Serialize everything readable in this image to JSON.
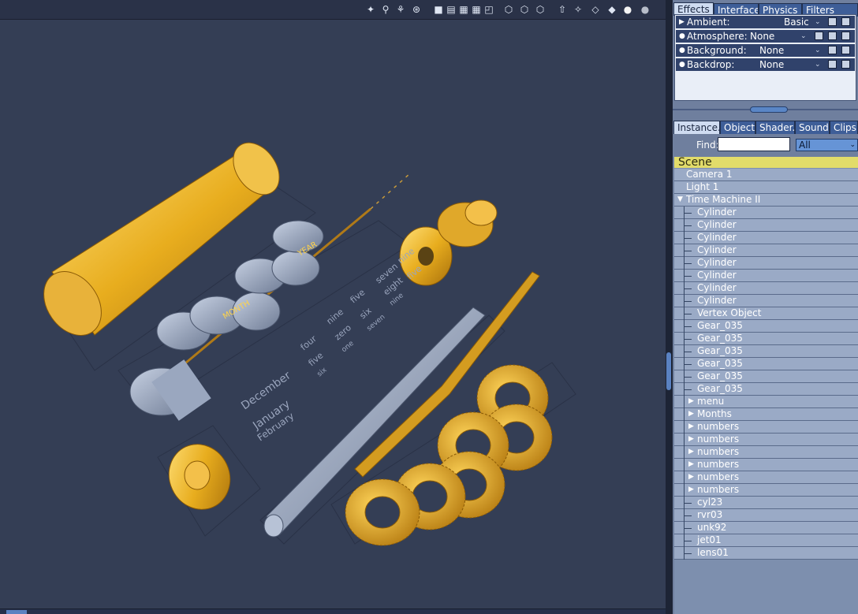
{
  "viewport_toolbar": {
    "icons": [
      "camera-icon",
      "figure-icon",
      "walk-icon",
      "sphere-grid-icon",
      "single-view-icon",
      "two-view-icon",
      "three-view-icon",
      "four-view-icon",
      "split-view-icon",
      "cube-wire-icon",
      "cube-lit-icon",
      "cube-shade-icon",
      "light-icon",
      "rotate-icon",
      "box-icon",
      "hidden-line-icon",
      "shaded-sphere-icon",
      "texture-sphere-icon"
    ]
  },
  "scene_labels": {
    "months": [
      "December",
      "January",
      "February"
    ],
    "numbers_col1": [
      "four",
      "five",
      "six"
    ],
    "numbers_col2": [
      "nine",
      "zero",
      "one"
    ],
    "numbers_col3": [
      "five",
      "six",
      "seven"
    ],
    "numbers_col4": [
      "seven",
      "eight",
      "nine"
    ],
    "numbers_col5": [
      "nine",
      "five"
    ],
    "bar_text_1": "MONTH",
    "bar_text_2": "YEAR"
  },
  "panel": {
    "effects_tabs": [
      "Effects",
      "Interface",
      "Physics",
      "Filters"
    ],
    "effects_rows": [
      {
        "label": "Ambient:",
        "value": "Basic",
        "marker": "▶"
      },
      {
        "label": "Atmosphere:",
        "value": "None",
        "marker": "●"
      },
      {
        "label": "Background:",
        "value": "None",
        "marker": "●"
      },
      {
        "label": "Backdrop:",
        "value": "None",
        "marker": "●"
      }
    ],
    "lower_tabs": [
      "Instance.",
      "Object.",
      "Shader.",
      "Sound.",
      "Clips"
    ],
    "find_label": "Find:",
    "find_value": "",
    "filter_value": "All",
    "scene_label": "Scene",
    "tree": [
      {
        "label": "Camera 1",
        "indent": 0
      },
      {
        "label": "Light 1",
        "indent": 0
      },
      {
        "label": "Time Machine II",
        "indent": 0,
        "expanded": true
      },
      {
        "label": "Cylinder",
        "indent": 1
      },
      {
        "label": "Cylinder",
        "indent": 1
      },
      {
        "label": "Cylinder",
        "indent": 1
      },
      {
        "label": "Cylinder",
        "indent": 1
      },
      {
        "label": "Cylinder",
        "indent": 1
      },
      {
        "label": "Cylinder",
        "indent": 1
      },
      {
        "label": "Cylinder",
        "indent": 1
      },
      {
        "label": "Cylinder",
        "indent": 1
      },
      {
        "label": "Vertex Object",
        "indent": 1
      },
      {
        "label": "Gear_035",
        "indent": 1
      },
      {
        "label": "Gear_035",
        "indent": 1
      },
      {
        "label": "Gear_035",
        "indent": 1
      },
      {
        "label": "Gear_035",
        "indent": 1
      },
      {
        "label": "Gear_035",
        "indent": 1
      },
      {
        "label": "Gear_035",
        "indent": 1
      },
      {
        "label": "menu",
        "indent": 1,
        "group": true
      },
      {
        "label": "Months",
        "indent": 1,
        "group": true
      },
      {
        "label": "numbers",
        "indent": 1,
        "group": true
      },
      {
        "label": "numbers",
        "indent": 1,
        "group": true
      },
      {
        "label": "numbers",
        "indent": 1,
        "group": true
      },
      {
        "label": "numbers",
        "indent": 1,
        "group": true
      },
      {
        "label": "numbers",
        "indent": 1,
        "group": true
      },
      {
        "label": "numbers",
        "indent": 1,
        "group": true
      },
      {
        "label": "cyl23",
        "indent": 1
      },
      {
        "label": "rvr03",
        "indent": 1
      },
      {
        "label": "unk92",
        "indent": 1
      },
      {
        "label": "jet01",
        "indent": 1
      },
      {
        "label": "lens01",
        "indent": 1
      }
    ]
  }
}
